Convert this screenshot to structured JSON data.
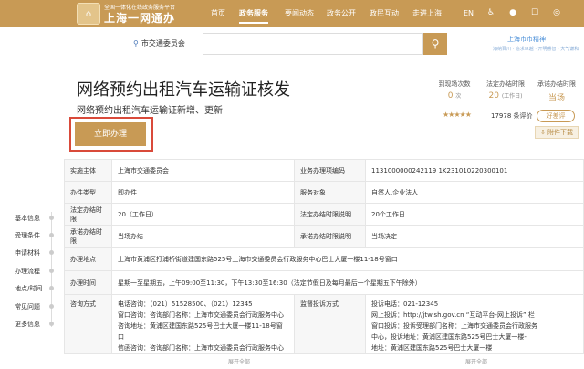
{
  "header": {
    "logo_glyph": "⌂",
    "logo_sub": "全国一体化在线政务服务平台",
    "logo_main": "上海一网通办",
    "nav": [
      "首页",
      "政务服务",
      "要闻动态",
      "政务公开",
      "政民互动",
      "走进上海"
    ],
    "active_nav": "政务服务",
    "lang": "EN",
    "accent_color": "#c89a55"
  },
  "search": {
    "dept": "市交通委员会",
    "placeholder": "",
    "brand": "上海市市精神",
    "brand_sub": "海纳百川 · 追求卓越 · 开明睿智 · 大气谦和"
  },
  "service": {
    "title": "网络预约出租汽车运输证核发",
    "subtitle": "网络预约出租汽车运输证新增、更新",
    "apply_label": "立即办理"
  },
  "stats": {
    "visits_label": "到现场次数",
    "visits_value": "0",
    "visits_unit": "次",
    "legal_label": "法定办结时限",
    "legal_value": "20",
    "legal_unit": "(工作日)",
    "promise_label": "承诺办结时限",
    "promise_value": "当场",
    "rating_stars": 5,
    "rating_text": "17978 条评价",
    "good_label": "好差评",
    "guide_label": "附件下载"
  },
  "sidenav": [
    "基本信息",
    "受理条件",
    "申请材料",
    "办理流程",
    "地点/时间",
    "常见问题",
    "更多信息"
  ],
  "table": {
    "r1": {
      "k1": "实施主体",
      "v1": "上海市交通委员会",
      "k2": "业务办理项编码",
      "v2": "1131000000242119 1K231010220300101"
    },
    "r2": {
      "k1": "办件类型",
      "v1": "即办件",
      "k2": "服务对象",
      "v2": "自然人,企业法人"
    },
    "r3": {
      "k1": "法定办结时限",
      "v1": "20（工作日）",
      "k2": "法定办结时限说明",
      "v2": "20个工作日"
    },
    "r4": {
      "k1": "承诺办结时限",
      "v1": "当场办结",
      "k2": "承诺办结时限说明",
      "v2": "当场决定"
    },
    "r5": {
      "k1": "办理地点",
      "v1": "上海市黄浦区打浦桥街道建国东路525号上海市交通委员会行政服务中心巴士大厦一楼11-18号窗口"
    },
    "r6": {
      "k1": "办理时间",
      "v1": "星期一至星期五，上午09:00至11:30，下午13:30至16:30（法定节假日及每月最后一个星期五下午除外）"
    },
    "r7": {
      "k1": "咨询方式",
      "v1a": "电话咨询：（021）51528500、（021）12345",
      "v1b": "窗口咨询：咨询部门名称：上海市交通委员会行政服务中心",
      "v1c": "咨询地址：黄浦区建国东路525号巴士大厦一楼11-18号窗口",
      "v1d": "信函咨询：咨询部门名称：上海市交通委员会行政服务中心",
      "k2": "监督投诉方式",
      "v2a": "投诉电话：021-12345",
      "v2b": "网上投诉：http://jtw.sh.gov.cn “互动平台-网上投诉” 栏",
      "v2c": "窗口投诉：投诉受理部门名称：上海市交通委员会行政服务",
      "v2d": "中心，投诉地址：黄浦区建国东路525号巴士大厦一楼-",
      "v2e": "地址：黄浦区建国东路525号巴士大厦一楼"
    },
    "more_label": "展开全部"
  }
}
